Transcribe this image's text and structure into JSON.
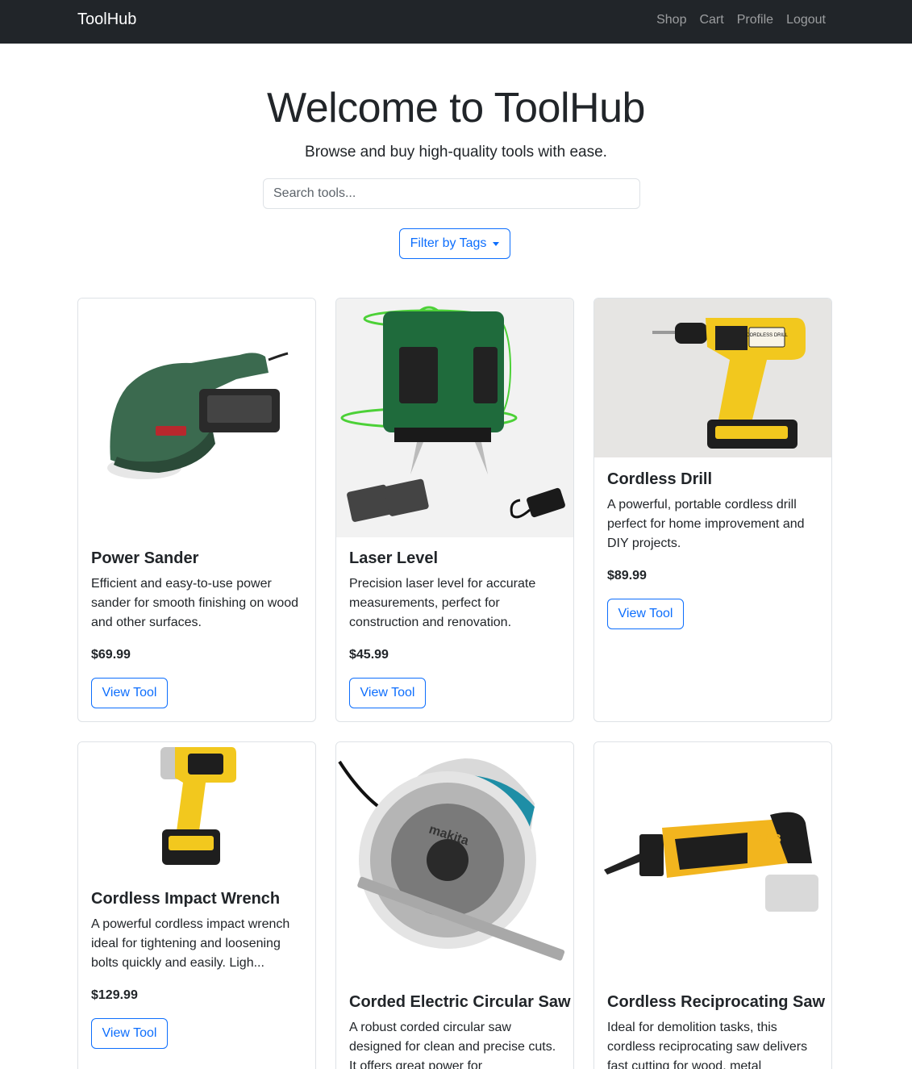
{
  "nav": {
    "brand": "ToolHub",
    "links": [
      "Shop",
      "Cart",
      "Profile",
      "Logout"
    ]
  },
  "hero": {
    "title": "Welcome to ToolHub",
    "subtitle": "Browse and buy high-quality tools with ease.",
    "search_placeholder": "Search tools...",
    "filter_label": "Filter by Tags"
  },
  "tools": [
    {
      "name": "Power Sander",
      "description": "Efficient and easy-to-use power sander for smooth finishing on wood and other surfaces.",
      "price": "$69.99",
      "button": "View Tool",
      "icon": "power-sander-image"
    },
    {
      "name": "Laser Level",
      "description": "Precision laser level for accurate measurements, perfect for construction and renovation.",
      "price": "$45.99",
      "button": "View Tool",
      "icon": "laser-level-image"
    },
    {
      "name": "Cordless Drill",
      "description": "A powerful, portable cordless drill perfect for home improvement and DIY projects.",
      "price": "$89.99",
      "button": "View Tool",
      "icon": "cordless-drill-image",
      "image_text": "CORDLESS DRILL"
    },
    {
      "name": "Cordless Impact Wrench",
      "description": "A powerful cordless impact wrench ideal for tightening and loosening bolts quickly and easily. Ligh...",
      "price": "$129.99",
      "button": "View Tool",
      "icon": "impact-wrench-image"
    },
    {
      "name": "Corded Electric Circular Saw",
      "description": "A robust corded circular saw designed for clean and precise cuts. It offers great power for",
      "icon": "circular-saw-image",
      "image_text": "makita"
    },
    {
      "name": "Cordless Reciprocating Saw",
      "description": "Ideal for demolition tasks, this cordless reciprocating saw delivers fast cutting for wood, metal",
      "icon": "reciprocating-saw-image",
      "image_text": "JCB"
    }
  ]
}
